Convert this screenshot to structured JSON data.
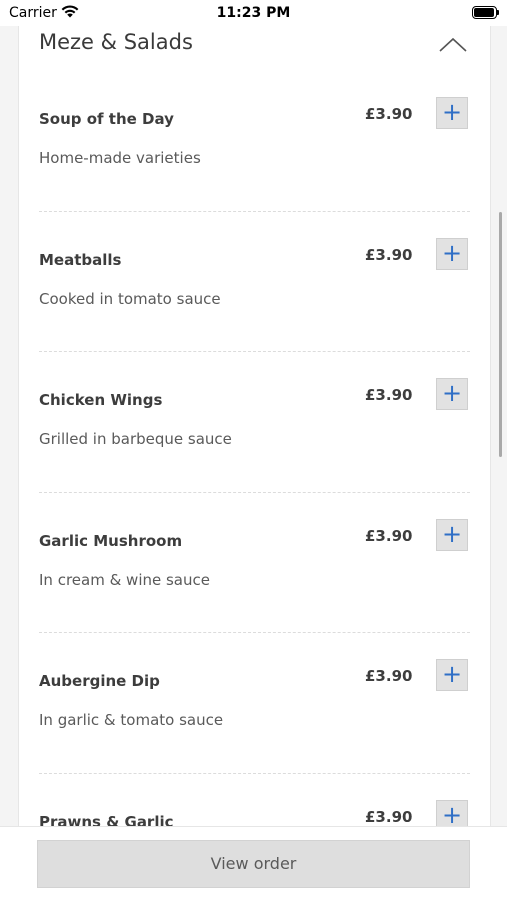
{
  "status_bar": {
    "carrier": "Carrier",
    "time": "11:23 PM",
    "icons": [
      "wifi-icon",
      "battery-icon"
    ]
  },
  "section": {
    "title": "Meze & Salads",
    "collapse_icon": "chevron-up-icon"
  },
  "items": [
    {
      "name": "Soup of the Day",
      "description": "Home-made varieties",
      "price": "£3.90",
      "add_label": "+"
    },
    {
      "name": "Meatballs",
      "description": "Cooked in tomato sauce",
      "price": "£3.90",
      "add_label": "+"
    },
    {
      "name": "Chicken Wings",
      "description": "Grilled in barbeque sauce",
      "price": "£3.90",
      "add_label": "+"
    },
    {
      "name": "Garlic Mushroom",
      "description": "In cream & wine sauce",
      "price": "£3.90",
      "add_label": "+"
    },
    {
      "name": "Aubergine Dip",
      "description": "In garlic & tomato sauce",
      "price": "£3.90",
      "add_label": "+"
    },
    {
      "name": "Prawns & Garlic",
      "description": "",
      "price": "£3.90",
      "add_label": "+"
    }
  ],
  "footer": {
    "view_order_label": "View order"
  },
  "colors": {
    "accent": "#2f6fc6",
    "button_bg": "#e2e2e2",
    "card_bg": "#ffffff",
    "page_bg": "#f4f4f4"
  }
}
